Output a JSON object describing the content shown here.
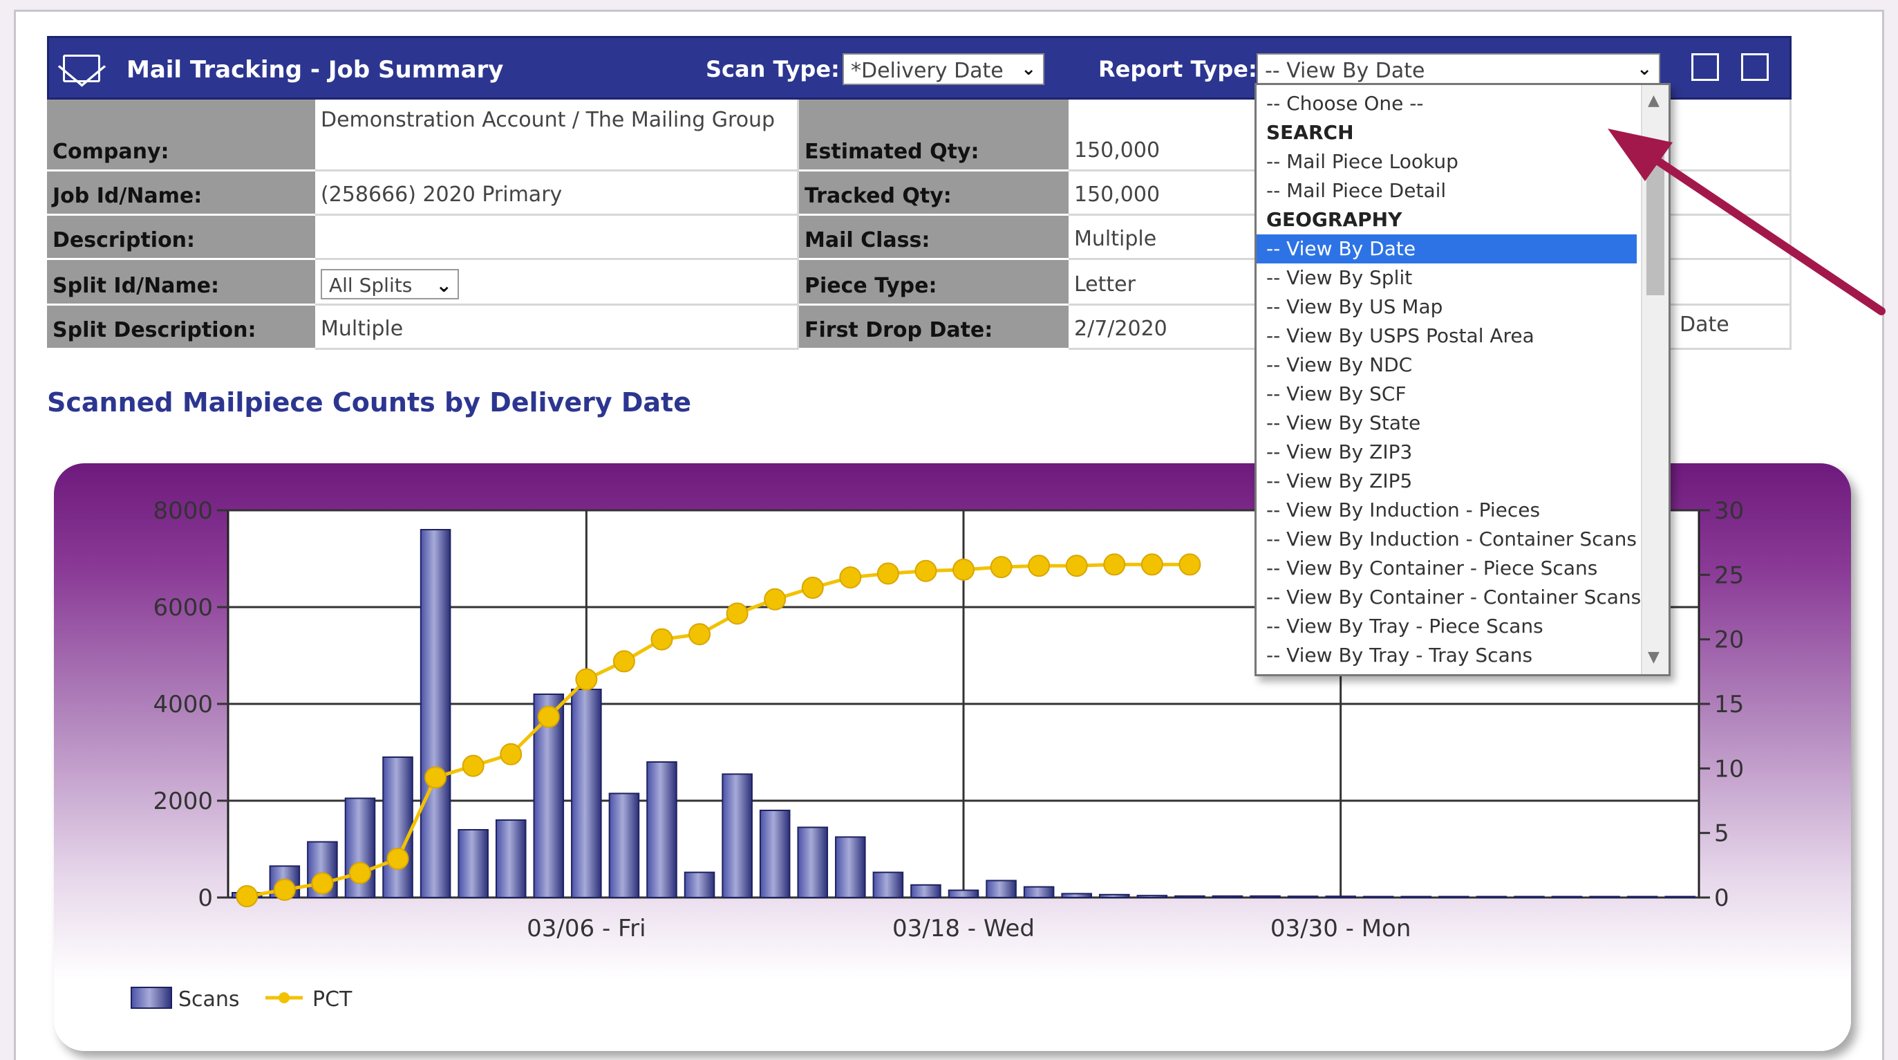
{
  "header": {
    "title": "Mail Tracking - Job Summary",
    "scan_type_label": "Scan Type:",
    "scan_type_value": "*Delivery Date",
    "report_type_label": "Report Type:",
    "report_type_value": "-- View By Date"
  },
  "info": {
    "company_label": "Company:",
    "company_value": "Demonstration Account / The Mailing Group",
    "job_label": "Job Id/Name:",
    "job_value": "(258666) 2020 Primary",
    "description_label": "Description:",
    "description_value": "",
    "split_label": "Split Id/Name:",
    "split_value": "All Splits",
    "split_desc_label": "Split Description:",
    "split_desc_value": "Multiple",
    "est_qty_label": "Estimated Qty:",
    "est_qty_value": "150,000",
    "tracked_qty_label": "Tracked Qty:",
    "tracked_qty_value": "150,000",
    "mail_class_label": "Mail Class:",
    "mail_class_value": "Multiple",
    "piece_type_label": "Piece Type:",
    "piece_type_value": "Letter",
    "first_drop_label": "First Drop Date:",
    "first_drop_value": "2/7/2020",
    "right_partial_text": "Date"
  },
  "section_title": "Scanned Mailpiece Counts by Delivery Date",
  "dropdown": {
    "options": [
      {
        "label": "-- Choose One --",
        "kind": "option"
      },
      {
        "label": "SEARCH",
        "kind": "group"
      },
      {
        "label": "-- Mail Piece Lookup",
        "kind": "option"
      },
      {
        "label": "-- Mail Piece Detail",
        "kind": "option"
      },
      {
        "label": "GEOGRAPHY",
        "kind": "group"
      },
      {
        "label": "-- View By Date",
        "kind": "selected"
      },
      {
        "label": "-- View By Split",
        "kind": "option"
      },
      {
        "label": "-- View By US Map",
        "kind": "option"
      },
      {
        "label": "-- View By USPS Postal Area",
        "kind": "option"
      },
      {
        "label": "-- View By NDC",
        "kind": "option"
      },
      {
        "label": "-- View By SCF",
        "kind": "option"
      },
      {
        "label": "-- View By State",
        "kind": "option"
      },
      {
        "label": "-- View By ZIP3",
        "kind": "option"
      },
      {
        "label": "-- View By ZIP5",
        "kind": "option"
      },
      {
        "label": "-- View By Induction - Pieces",
        "kind": "option"
      },
      {
        "label": "-- View By Induction - Container Scans",
        "kind": "option"
      },
      {
        "label": "-- View By Container - Piece Scans",
        "kind": "option"
      },
      {
        "label": "-- View By Container - Container Scans",
        "kind": "option"
      },
      {
        "label": "-- View By Tray - Piece Scans",
        "kind": "option"
      },
      {
        "label": "-- View By Tray - Tray Scans",
        "kind": "option"
      }
    ]
  },
  "colors": {
    "header_bg": "#2c3690",
    "bar": "#3a3f8f",
    "line": "#f2c200",
    "arrow": "#a3184a",
    "selected": "#2d73e6"
  },
  "chart_data": {
    "type": "bar+line",
    "x_tick_labels": [
      "03/06 - Fri",
      "03/18 - Wed",
      "03/30 - Mon"
    ],
    "y_left": {
      "ticks": [
        "0",
        "2000",
        "4000",
        "6000",
        "8000"
      ],
      "range": [
        0,
        8000
      ]
    },
    "y_right": {
      "ticks": [
        "0",
        "5",
        "10",
        "15",
        "20",
        "25",
        "30"
      ],
      "range": [
        0,
        30
      ]
    },
    "grid": true,
    "legend": {
      "position": "bottom-left",
      "items": [
        {
          "name": "Scans",
          "type": "bar"
        },
        {
          "name": "PCT",
          "type": "line"
        }
      ]
    },
    "series": [
      {
        "name": "Scans",
        "axis": "left",
        "values": [
          100,
          650,
          1150,
          2050,
          2900,
          7600,
          1400,
          1600,
          4200,
          4300,
          2150,
          2800,
          520,
          2550,
          1800,
          1450,
          1250,
          520,
          260,
          150,
          350,
          220,
          80,
          60,
          40,
          30,
          30,
          30,
          25,
          25,
          20,
          20,
          20,
          20,
          20,
          20,
          20,
          20,
          20
        ]
      },
      {
        "name": "PCT",
        "axis": "right",
        "values": [
          0.1,
          0.6,
          1.1,
          1.9,
          3,
          9.3,
          10.2,
          11.1,
          14,
          16.9,
          18.3,
          20,
          20.4,
          22,
          23.1,
          24,
          24.8,
          25.1,
          25.3,
          25.4,
          25.6,
          25.7,
          25.7,
          25.8,
          25.8,
          25.8
        ]
      }
    ]
  }
}
